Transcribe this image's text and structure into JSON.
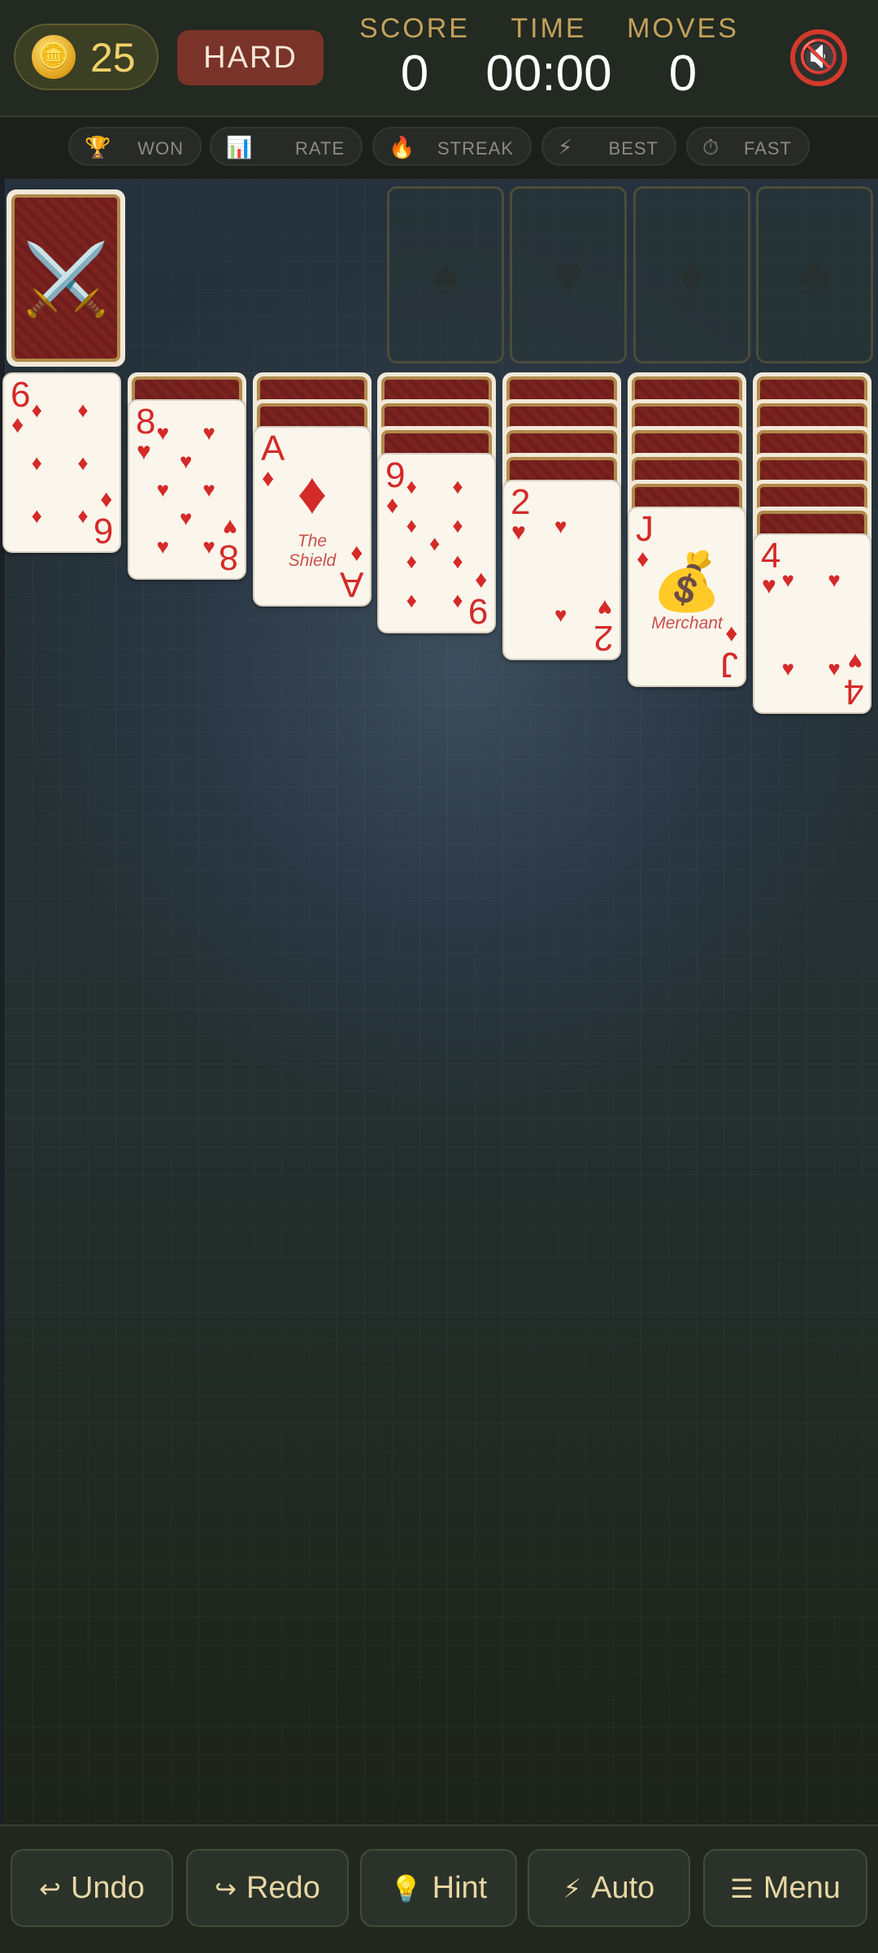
{
  "header": {
    "coins": "25",
    "coin_icon": "coin-icon",
    "difficulty": "HARD",
    "score_label": "SCORE",
    "score_value": "0",
    "time_label": "TIME",
    "time_value": "00:00",
    "moves_label": "MOVES",
    "moves_value": "0",
    "mute_icon": "sound-muted-icon"
  },
  "stats": [
    {
      "icon": "🏆",
      "label": "WON"
    },
    {
      "icon": "📊",
      "label": "RATE"
    },
    {
      "icon": "🔥",
      "label": "STREAK"
    },
    {
      "icon": "⚡",
      "label": "BEST"
    },
    {
      "icon": "⏱",
      "label": "FAST"
    }
  ],
  "foundations": [
    {
      "suit": "♠"
    },
    {
      "suit": "♥"
    },
    {
      "suit": "♦"
    },
    {
      "suit": "♣"
    }
  ],
  "stock": {
    "emblem": "⚔️"
  },
  "tableau": [
    {
      "facedown": 0,
      "top": {
        "rank": "6",
        "suit": "♦",
        "color": "red"
      }
    },
    {
      "facedown": 1,
      "top": {
        "rank": "8",
        "suit": "♥",
        "color": "red"
      }
    },
    {
      "facedown": 2,
      "top": {
        "rank": "A",
        "suit": "♦",
        "color": "red",
        "caption": "The Shield"
      }
    },
    {
      "facedown": 3,
      "top": {
        "rank": "9",
        "suit": "♦",
        "color": "red"
      }
    },
    {
      "facedown": 4,
      "top": {
        "rank": "2",
        "suit": "♥",
        "color": "red"
      }
    },
    {
      "facedown": 5,
      "top": {
        "rank": "J",
        "suit": "♦",
        "color": "red",
        "caption": "Merchant",
        "emblem": "💰"
      }
    },
    {
      "facedown": 6,
      "top": {
        "rank": "4",
        "suit": "♥",
        "color": "red"
      }
    }
  ],
  "controls": [
    {
      "icon": "↩",
      "label": "Undo"
    },
    {
      "icon": "↪",
      "label": "Redo"
    },
    {
      "icon": "💡",
      "label": "Hint"
    },
    {
      "icon": "⚡",
      "label": "Auto"
    },
    {
      "icon": "☰",
      "label": "Menu"
    }
  ],
  "colors": {
    "card_red": "#d42a28",
    "accent_gold": "#c4a15a",
    "difficulty_bg": "#7a3328"
  }
}
